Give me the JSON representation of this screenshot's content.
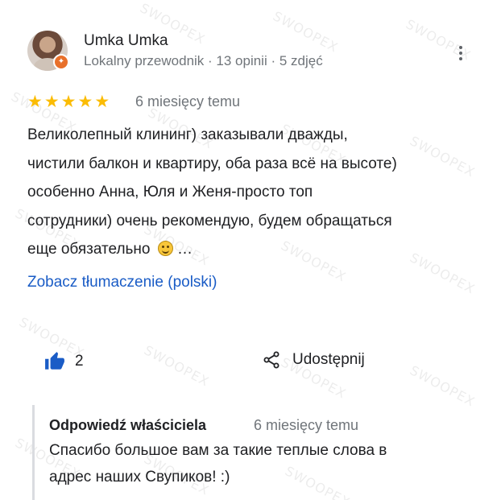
{
  "watermark_text": "SWOOPEX",
  "review": {
    "author": {
      "name": "Umka Umka",
      "meta": "Lokalny przewodnik · 13 opinii · 5 zdjęć",
      "avatar_icon": "user-avatar",
      "badge_icon": "local-guide-badge-icon"
    },
    "rating": 5,
    "rating_max": 5,
    "star_glyph": "★",
    "date": "6 miesięcy temu",
    "text_lines": [
      "Великолепный клининг) заказывали дважды,",
      "чистили балкон и квартиру, оба раза всё на высоте)",
      "особенно Анна, Юля и Женя-просто топ",
      "сотрудники) очень рекомендую, будем обращаться",
      "еще обязательно"
    ],
    "text_suffix": "…",
    "emoji_icon": "smiling-face-emoji",
    "translate_link": "Zobacz tłumaczenie (polski)",
    "likes": "2",
    "like_icon": "thumbs-up-icon",
    "share_icon": "share-icon",
    "share_label": "Udostępnij",
    "more_icon": "more-vert-icon"
  },
  "owner_reply": {
    "label": "Odpowiedź właściciela",
    "date": "6 miesięcy temu",
    "text_lines": [
      "Спасибо большое вам за такие теплые слова в",
      "адрес наших Свупиков! :)"
    ]
  },
  "colors": {
    "star": "#fbbc04",
    "link": "#1a5cc6",
    "like_icon": "#1a5cc6",
    "meta_text": "#70757a",
    "badge": "#e8702a"
  }
}
